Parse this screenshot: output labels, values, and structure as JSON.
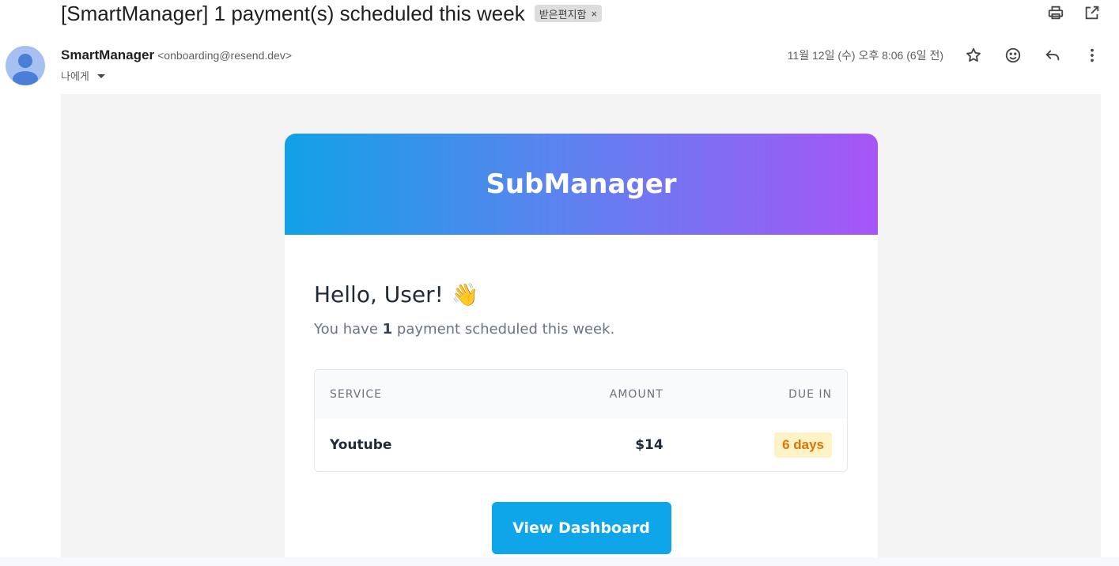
{
  "subject": "[SmartManager] 1 payment(s) scheduled this week",
  "label_chip": "받은편지함",
  "chip_remove": "×",
  "sender": {
    "name": "SmartManager",
    "email": "<onboarding@resend.dev>",
    "to": "나에게"
  },
  "date": "11월 12일 (수) 오후 8:06 (6일 전)",
  "icons": {
    "print": "print-icon",
    "open_new": "open-in-new-icon",
    "star": "star-icon",
    "emoji": "emoji-icon",
    "reply": "reply-icon",
    "more": "more-vert-icon"
  },
  "email": {
    "brand": "SubManager",
    "greeting": "Hello, User!",
    "wave": "👋",
    "summary_prefix": "You have",
    "summary_count": "1",
    "summary_suffix": "payment scheduled this week.",
    "table": {
      "headers": [
        "SERVICE",
        "AMOUNT",
        "DUE IN"
      ],
      "rows": [
        {
          "service": "Youtube",
          "amount": "$14",
          "due": "6 days"
        }
      ]
    },
    "cta": "View Dashboard"
  },
  "colors": {
    "gradient_start": "#12a1e6",
    "gradient_end": "#a855f7",
    "cta": "#0ea5e9",
    "due_badge_bg": "#fef3c7",
    "due_badge_text": "#d97706"
  }
}
